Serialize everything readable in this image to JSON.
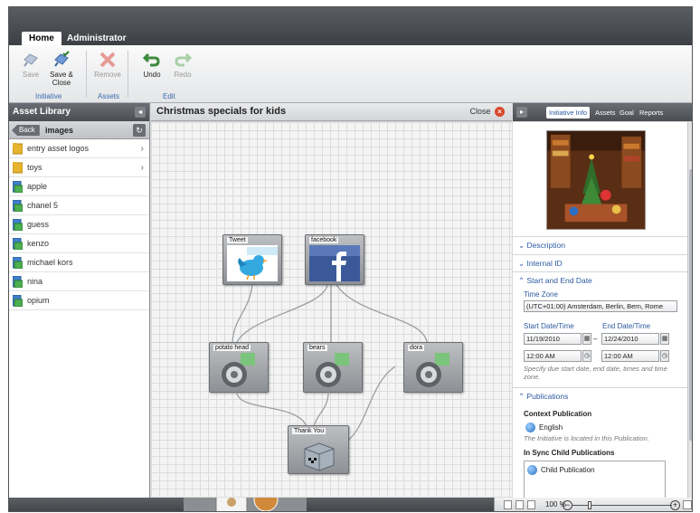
{
  "tabs": [
    {
      "label": "Home",
      "active": true
    },
    {
      "label": "Administrator",
      "active": false
    }
  ],
  "ribbon": {
    "save": "Save",
    "save_close": "Save & Close",
    "remove": "Remove",
    "undo": "Undo",
    "redo": "Redo",
    "group_initiative": "Initiative",
    "group_assets": "Assets",
    "group_edit": "Edit"
  },
  "left_panel": {
    "title": "Asset Library",
    "back": "Back",
    "folder": "images",
    "items": [
      {
        "label": "entry asset logos",
        "type": "folder"
      },
      {
        "label": "toys",
        "type": "folder"
      },
      {
        "label": "apple",
        "type": "asset"
      },
      {
        "label": "chanel 5",
        "type": "asset"
      },
      {
        "label": "guess",
        "type": "asset"
      },
      {
        "label": "kenzo",
        "type": "asset"
      },
      {
        "label": "michael kors",
        "type": "asset"
      },
      {
        "label": "nina",
        "type": "asset"
      },
      {
        "label": "opium",
        "type": "asset"
      }
    ]
  },
  "canvas": {
    "title": "Christmas specials for kids",
    "close": "Close",
    "nodes": {
      "tweet": "Tweet",
      "facebook": "facebook",
      "potato": "potato head",
      "bears": "bears",
      "dora": "dora",
      "thankyou": "Thank You"
    }
  },
  "right_panel": {
    "tabs": [
      "Initiative Info",
      "Assets",
      "Goal",
      "Reports"
    ],
    "active_tab": "Initiative Info",
    "description": "Description",
    "internal_id": "Internal ID",
    "start_end": "Start and End Date",
    "time_zone_label": "Time Zone",
    "time_zone_value": "(UTC+01:00) Amsterdam, Berlin, Bern, Rome",
    "start_label": "Start Date/Time",
    "end_label": "End Date/Time",
    "start_date": "11/19/2010",
    "end_date": "12/24/2010",
    "start_time": "12:00 AM",
    "end_time": "12:00 AM",
    "dash": "–",
    "date_note": "Specify due start date, end date, times and time zone.",
    "publications": "Publications",
    "context_pub": "Context Publication",
    "language": "English",
    "context_note": "The Initiative is located in this Publication.",
    "in_sync": "In Sync Child Publications",
    "child_pub": "Child Publication"
  },
  "status": {
    "zoom": "100 %"
  },
  "colors": {
    "accent": "#2c5aa0",
    "close_red": "#d9472b",
    "header_dark": "#4a4d52"
  }
}
